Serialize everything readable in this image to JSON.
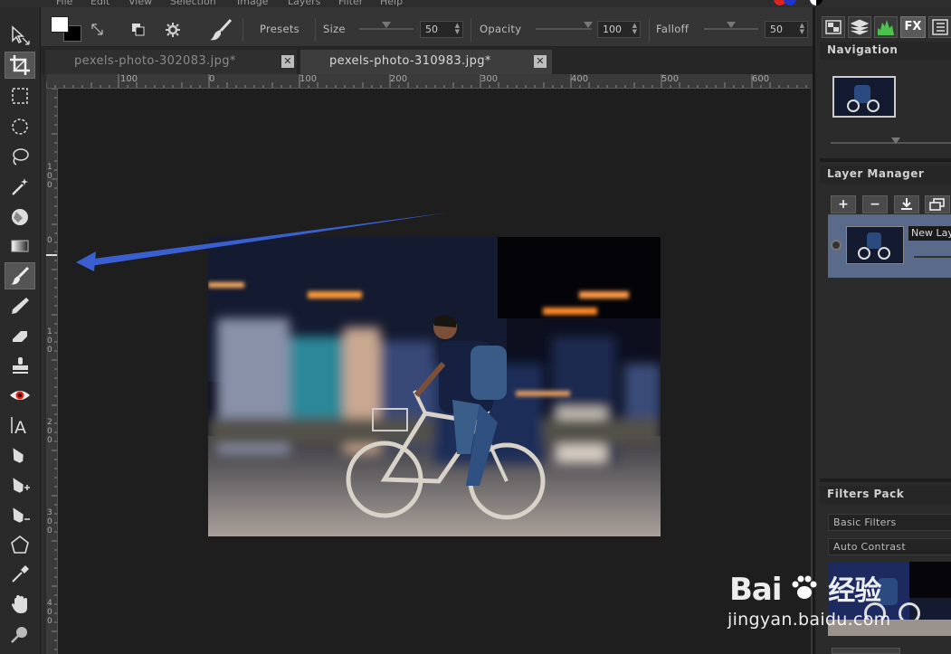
{
  "menu": [
    "File",
    "Edit",
    "View",
    "Selection",
    "Image",
    "Layers",
    "Filter",
    "Help"
  ],
  "options": {
    "presets_label": "Presets",
    "size_label": "Size",
    "size_value": "50",
    "opacity_label": "Opacity",
    "opacity_value": "100",
    "falloff_label": "Falloff",
    "falloff_value": "50"
  },
  "tabs": [
    {
      "label": "pexels-photo-302083.jpg*",
      "close": "✕"
    },
    {
      "label": "pexels-photo-310983.jpg*",
      "close": "✕"
    }
  ],
  "ruler": {
    "h_ticks": [
      "100",
      "0",
      "100",
      "200",
      "300",
      "400",
      "500",
      "600"
    ],
    "v_ticks": [
      "100",
      "0",
      "100",
      "200",
      "300",
      "400"
    ]
  },
  "tools": [
    "move-icon",
    "crop-icon",
    "rect-select-icon",
    "ellipse-select-icon",
    "lasso-icon",
    "magic-wand-icon",
    "fill-icon",
    "gradient-icon",
    "brush-icon",
    "pencil-icon",
    "eraser-icon",
    "stamp-icon",
    "red-eye-icon",
    "text-icon",
    "pen-icon",
    "pen-add-icon",
    "pen-remove-icon",
    "shape-icon",
    "eyedropper-icon",
    "hand-icon",
    "zoom-icon"
  ],
  "panel": {
    "tabs_icons": [
      "layers-view-icon",
      "stack-icon",
      "histogram-icon",
      "fx-icon",
      "list-icon"
    ],
    "fx_label": "FX",
    "navigation_title": "Navigation",
    "layer_manager_title": "Layer Manager",
    "layer_buttons": [
      "+",
      "−",
      "merge-down-icon",
      "duplicate-icon"
    ],
    "layer_name": "New Lay",
    "filters_title": "Filters Pack",
    "filter_category": "Basic Filters",
    "filter_name": "Auto Contrast"
  },
  "watermark": {
    "brand": "Bai",
    "brand2": "经验",
    "url": "jingyan.baidu.com"
  },
  "colors": {
    "accent_arrow": "#3a5fd0",
    "panel_bg": "#2b2b2b",
    "layer_selected": "#5a6a8a"
  }
}
